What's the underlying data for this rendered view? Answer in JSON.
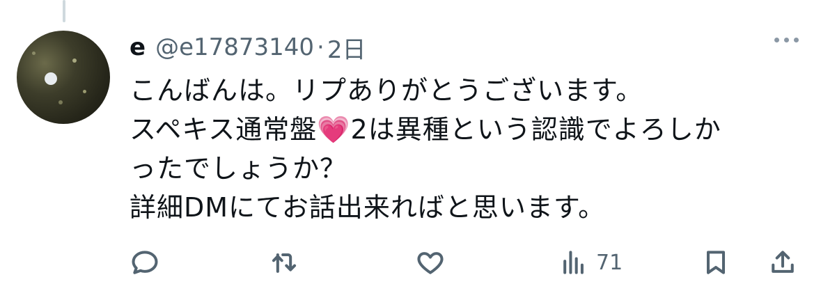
{
  "tweet": {
    "display_name": "e",
    "handle": "@e17873140",
    "separator": "·",
    "time": "2日",
    "body_lines": [
      "こんばんは。リプありがとうございます。",
      "スペキス通常盤💗2は異種という認識でよろしか",
      "ったでしょうか？",
      "詳細DMにてお話出来ればと思います。"
    ]
  },
  "actions": {
    "reply_icon": "reply-icon",
    "retweet_icon": "retweet-icon",
    "like_icon": "heart-icon",
    "views_icon": "views-icon",
    "views_count": "71",
    "bookmark_icon": "bookmark-icon",
    "share_icon": "share-icon"
  },
  "colors": {
    "text": "#0f1419",
    "muted": "#536471",
    "heart_emoji": "#ff5db1"
  }
}
